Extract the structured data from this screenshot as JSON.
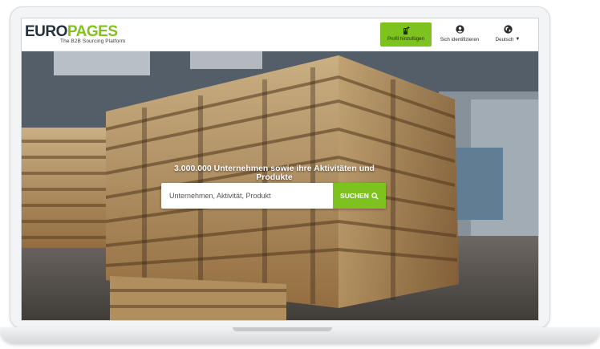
{
  "header": {
    "logo": {
      "word_dark": "EURO",
      "word_green": "PAGES",
      "tagline": "The B2B Sourcing Platform"
    },
    "add_profile_label": "Profil hinzufügen",
    "signin_label": "Sich identifizieren",
    "language_label": "Deutsch"
  },
  "hero": {
    "headline": "3.000.000 Unternehmen sowie ihre Aktivitäten und Produkte",
    "search": {
      "placeholder": "Unternehmen, Aktivität, Produkt",
      "value": "",
      "button_label": "SUCHEN"
    }
  },
  "colors": {
    "brand_green": "#7dc21e",
    "brand_dark": "#24313a"
  },
  "icons": {
    "add_profile": "building-plus-icon",
    "signin": "user-circle-icon",
    "language": "globe-icon",
    "search": "search-icon"
  }
}
